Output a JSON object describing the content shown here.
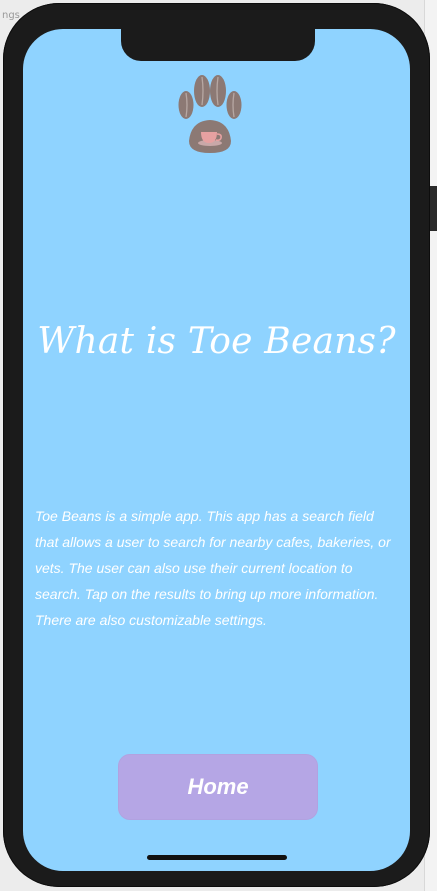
{
  "background": {
    "top_text": "ngs"
  },
  "app": {
    "logo_icon": "paw-coffee-cup-icon",
    "title": "What is Toe Beans?",
    "description": "Toe Beans is a simple app. This app has a search field that allows a user to search for nearby cafes, bakeries, or vets. The user can also use their current location to search. Tap on the results to bring up more information. There are also customizable settings.",
    "home_button_label": "Home"
  },
  "colors": {
    "screen_bg": "#8fd3ff",
    "button_bg": "#b5a6e5",
    "text": "#ffffff",
    "paw": "#8c7974",
    "cup": "#e6a1a1"
  }
}
